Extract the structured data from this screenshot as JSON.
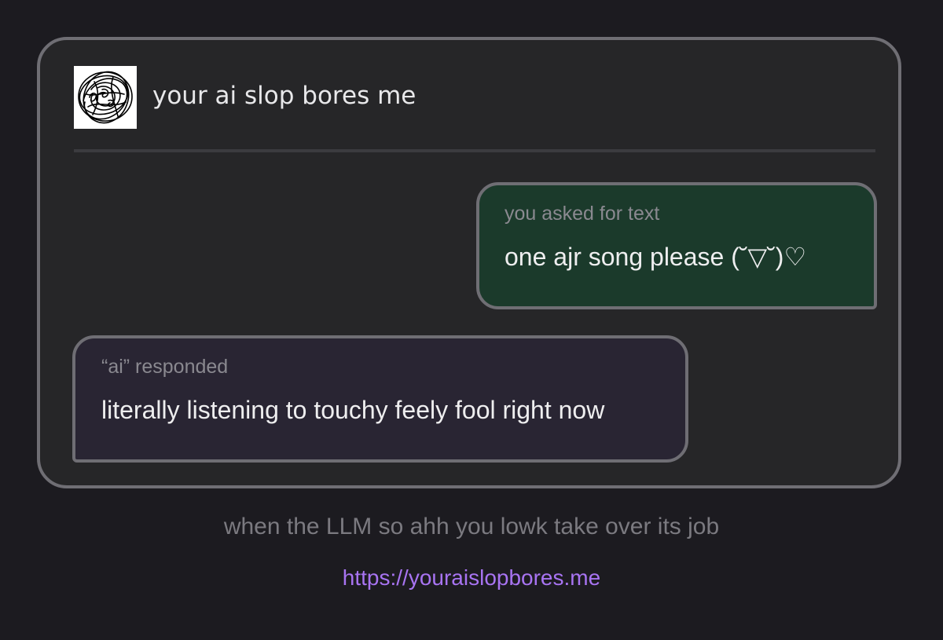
{
  "header": {
    "avatar_icon": "scribble-logo-icon",
    "title": "your ai slop bores me"
  },
  "messages": [
    {
      "role": "user",
      "label": "you asked for text",
      "text": "one ajr song please (˘▽˘)♡"
    },
    {
      "role": "ai",
      "label": "“ai” responded",
      "text": "literally listening to touchy feely fool right now"
    }
  ],
  "footer": {
    "caption": "when the LLM so ahh you lowk take over its job",
    "link": "https://youraislopbores.me"
  },
  "colors": {
    "background": "#1c1b20",
    "card": "#262628",
    "border": "#6f6e74",
    "user_bubble": "#1b3a2b",
    "ai_bubble": "#292533",
    "link": "#a874f2"
  }
}
